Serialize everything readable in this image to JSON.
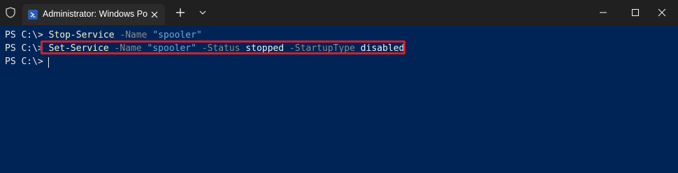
{
  "window": {
    "tab_title": "Administrator: Windows Powe",
    "icons": {
      "shield": "shield-icon",
      "powershell": "powershell-icon",
      "tab_close": "close-icon",
      "new_tab": "plus-icon",
      "dropdown": "chevron-down-icon",
      "minimize": "minimize-icon",
      "maximize": "maximize-icon",
      "close": "close-icon"
    }
  },
  "terminal": {
    "prompt": "PS C:\\>",
    "lines": [
      {
        "command": "Stop-Service",
        "param1": "-Name",
        "value1": "\"spooler\""
      },
      {
        "command": "Set-Service",
        "param1": "-Name",
        "value1": "\"spooler\"",
        "param2": "-Status",
        "value2": "stopped",
        "param3": "-StartupType",
        "value3": "disabled"
      }
    ]
  },
  "colors": {
    "terminal_background": "#012456",
    "highlight_border": "#d11f2f"
  }
}
